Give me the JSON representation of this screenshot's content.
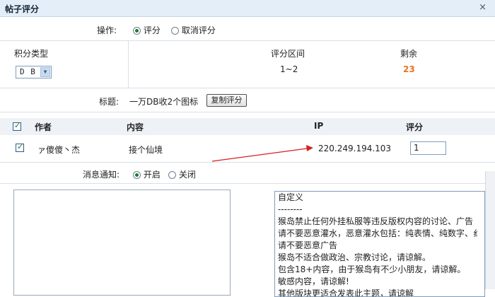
{
  "dialog": {
    "title": "帖子评分",
    "close_glyph": "×"
  },
  "operation": {
    "label": "操作:",
    "options": [
      {
        "label": "评分",
        "checked": true
      },
      {
        "label": "取消评分",
        "checked": false
      }
    ]
  },
  "score_type": {
    "label": "积分类型",
    "selected": "D B"
  },
  "range": {
    "label": "评分区间",
    "value": "1~2"
  },
  "remaining": {
    "label": "剩余",
    "value": "23",
    "color": "#e8731c"
  },
  "post_title": {
    "label": "标题:",
    "value": "一万DB收2个图标",
    "copy_button": "复制评分"
  },
  "table": {
    "headers": {
      "author": "作者",
      "content": "内容",
      "ip": "IP",
      "score": "评分"
    },
    "row": {
      "checked": true,
      "author": "ァ傻傻丶杰",
      "content": "接个仙境",
      "ip": "220.249.194.103",
      "score": "1"
    }
  },
  "notify": {
    "label": "消息通知:",
    "options": [
      {
        "label": "开启",
        "checked": true
      },
      {
        "label": "关闭",
        "checked": false
      }
    ]
  },
  "reasons": {
    "items": [
      "自定义",
      "--------",
      "猴岛禁止任何外挂私服等违反版权内容的讨论、广告",
      "请不要恶意灌水，恶意灌水包括：纯表情、纯数字、纟",
      "请不要恶意广告",
      "猴岛不适合做政治、宗教讨论，请谅解。",
      "包含18+内容，由于猴岛有不少小朋友，请谅解。",
      "敏感内容，请谅解!",
      "其他版块更适合发表此主题，请谅解"
    ]
  },
  "colors": {
    "arrow": "#d42020",
    "header_bg": "#eef2f7"
  }
}
